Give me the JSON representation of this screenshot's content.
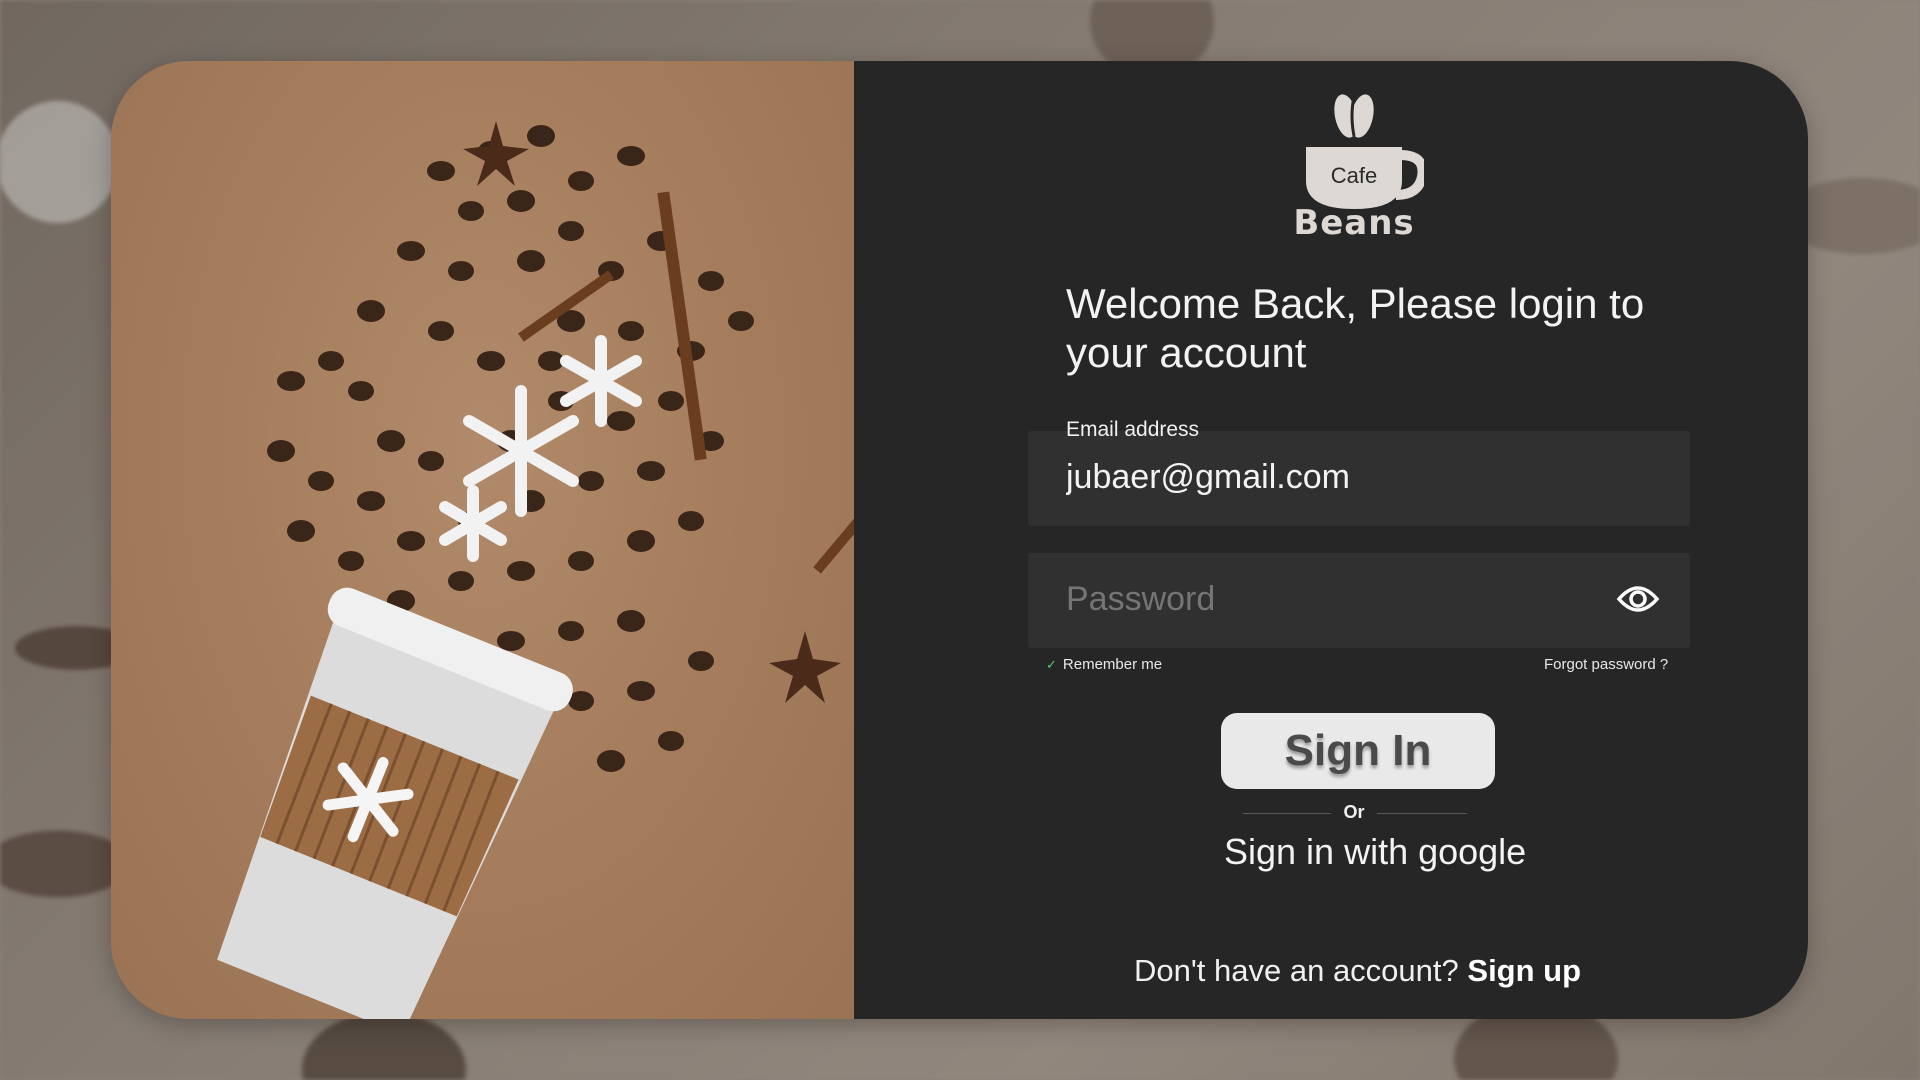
{
  "logo": {
    "top_text": "Cafe",
    "bottom_text": "Beans"
  },
  "welcome_text": "Welcome Back, Please login to your account",
  "email": {
    "label": "Email address",
    "value": "jubaer@gmail.com"
  },
  "password": {
    "placeholder": "Password",
    "toggle_icon": "eye-icon"
  },
  "remember_me": {
    "label": "Remember me",
    "checked": true
  },
  "forgot_password_label": "Forgot password ?",
  "signin_label": "Sign In",
  "divider_label": "Or",
  "google_label": "Sign in with google",
  "signup": {
    "prompt": "Don't have an account?",
    "link_label": "Sign up"
  },
  "colors": {
    "panel_bg": "#262626",
    "field_bg": "#303030",
    "button_bg": "#e9e9e9",
    "photo_bg": "#a57d5d",
    "check_color": "#4ecb71"
  }
}
